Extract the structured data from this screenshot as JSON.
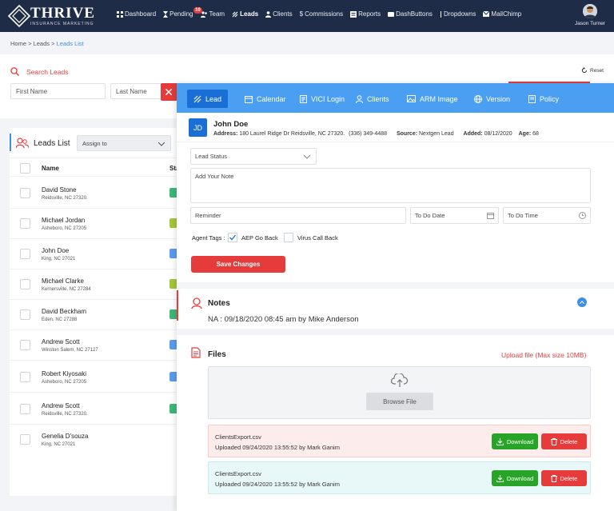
{
  "nav": {
    "brand": "THRIVE",
    "tagline": "INSURANCE MARKETING",
    "items": [
      {
        "label": "Dashboard",
        "icon": "grid-icon"
      },
      {
        "label": "Pending",
        "icon": "hourglass-icon"
      },
      {
        "label": "Team",
        "icon": "team-icon"
      },
      {
        "label": "Leads",
        "icon": "leads-icon"
      },
      {
        "label": "Clients",
        "icon": "user-icon"
      },
      {
        "label": "Commissions",
        "icon": "dollar-icon"
      },
      {
        "label": "Reports",
        "icon": "report-icon"
      },
      {
        "label": "DashButtons",
        "icon": "buttons-icon"
      },
      {
        "label": "Dropdowns",
        "icon": "dropdown-icon"
      },
      {
        "label": "MailChimp",
        "icon": "mail-icon"
      }
    ],
    "pending_badge": "10",
    "user_name": "Jason Turner"
  },
  "breadcrumb": {
    "home": "Home",
    "sep1": " > ",
    "leads": "Leads",
    "sep2": " > ",
    "current": "Leads List"
  },
  "search": {
    "title": "Search Leads",
    "first_name_placeholder": "First Name",
    "last_name_placeholder": "Last Name",
    "reset_label": "Reset"
  },
  "leads_list": {
    "title": "Leads List",
    "assign_label": "Assign to",
    "col_name": "Name",
    "col_status": "Sta",
    "rows": [
      {
        "name": "David Stone",
        "address": "Reidsville, NC 27320.",
        "status_color": "#3cb878"
      },
      {
        "name": "Michael Jordan",
        "address": "Asheboro, NC 27205",
        "status_color": "#a4c639"
      },
      {
        "name": "John Doe",
        "address": "King, NC 27021",
        "status_color": "#5b9bec"
      },
      {
        "name": "Michael Clarke",
        "address": "Kernersville, NC 27284",
        "status_color": "#a4c639"
      },
      {
        "name": "David Beckham",
        "address": "Eden, NC 27288",
        "status_color": "#3cb878"
      },
      {
        "name": "Andrew Scott",
        "address": "Winston Salem, NC 27127",
        "status_color": "#5b9bec"
      },
      {
        "name": "Robert Kiyosaki",
        "address": "Asheboro, NC 27205",
        "status_color": "#5b9bec"
      },
      {
        "name": "Andrew Scott",
        "address": "Reidsville, NC 27320.",
        "status_color": "#3cb878"
      },
      {
        "name": "Genelia D'souza",
        "address": "King, NC 27021",
        "status_color": ""
      }
    ]
  },
  "modal": {
    "tabs": [
      {
        "label": "Lead",
        "icon": "lead-icon",
        "active": true
      },
      {
        "label": "Calendar",
        "icon": "calendar-icon",
        "active": false
      },
      {
        "label": "VICI Login",
        "icon": "document-icon",
        "active": false
      },
      {
        "label": "Clients",
        "icon": "user-icon",
        "active": false
      },
      {
        "label": "ARM Image",
        "icon": "image-icon",
        "active": false
      },
      {
        "label": "Version",
        "icon": "globe-icon",
        "active": false
      },
      {
        "label": "Policy",
        "icon": "policy-icon",
        "active": false
      }
    ],
    "lead": {
      "initials": "JD",
      "name": "John Doe",
      "address_label": "Address:",
      "address": "180 Laurel Ridge Dr Reidsville, NC 27320.",
      "phone": "(336) 349-4488",
      "source_label": "Source:",
      "source": "Nextgen Lead",
      "added_label": "Added:",
      "added": "08/12/2020",
      "age_label": "Age:",
      "age": "68"
    },
    "form": {
      "lead_status_placeholder": "Lead Status",
      "note_placeholder": "Add Your Note",
      "reminder_placeholder": "Reminder",
      "todo_date_placeholder": "To Do Date",
      "todo_time_placeholder": "To Do Time",
      "agent_tags_label": "Agent Tags :",
      "tag1_label": "AEP Go Back",
      "tag1_checked": true,
      "tag2_label": "Virus Call Back",
      "tag2_checked": false,
      "save_label": "Save Changes"
    },
    "notes": {
      "title": "Notes",
      "entry": "NA : 09/18/2020 08:45 am by Mike Anderson"
    },
    "files": {
      "title": "Files",
      "upload_label": "Upload file (Max size 10MB)",
      "browse_label": "Browse File",
      "download_label": "Download",
      "delete_label": "Delete",
      "items": [
        {
          "name": "ClientsExport.csv",
          "uploaded": "Uploaded 09/24/2020 13:55:52 by Mark Ganim"
        },
        {
          "name": "ClientsExport.csv",
          "uploaded": "Uploaded 09/24/2020 13:55:52 by Mark Ganim"
        }
      ]
    }
  },
  "colors": {
    "nav_bg": "#1f2c47",
    "tab_bar": "#4b9ff2",
    "tab_active": "#1a6fd6",
    "accent_red": "#e53b3b",
    "download_green": "#28a428",
    "delete_red": "#e53b3b"
  }
}
